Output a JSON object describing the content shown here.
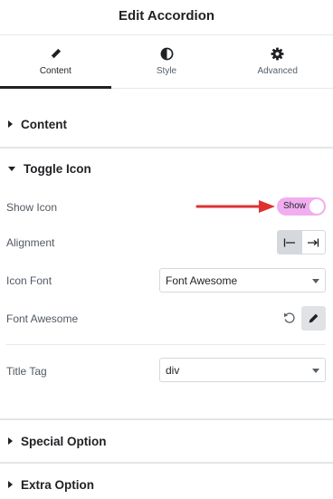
{
  "header": {
    "title": "Edit Accordion"
  },
  "tabs": [
    {
      "label": "Content",
      "icon": "pencil-icon",
      "active": true
    },
    {
      "label": "Style",
      "icon": "half-circle-icon",
      "active": false
    },
    {
      "label": "Advanced",
      "icon": "gear-icon",
      "active": false
    }
  ],
  "sections": {
    "content": {
      "label": "Content",
      "expanded": false
    },
    "toggle_icon": {
      "label": "Toggle Icon",
      "expanded": true
    },
    "special_option": {
      "label": "Special Option",
      "expanded": false
    },
    "extra_option": {
      "label": "Extra Option",
      "expanded": false
    }
  },
  "controls": {
    "show_icon": {
      "label": "Show Icon",
      "toggle_text": "Show",
      "on": true
    },
    "alignment": {
      "label": "Alignment",
      "options": [
        "left-align-icon",
        "right-align-icon"
      ],
      "selected": 0
    },
    "icon_font": {
      "label": "Icon Font",
      "value": "Font Awesome"
    },
    "font_awesome": {
      "label": "Font Awesome"
    },
    "title_tag": {
      "label": "Title Tag",
      "value": "div"
    }
  },
  "colors": {
    "toggle_bg": "#f0aef0",
    "annotation_arrow": "#e03131"
  }
}
